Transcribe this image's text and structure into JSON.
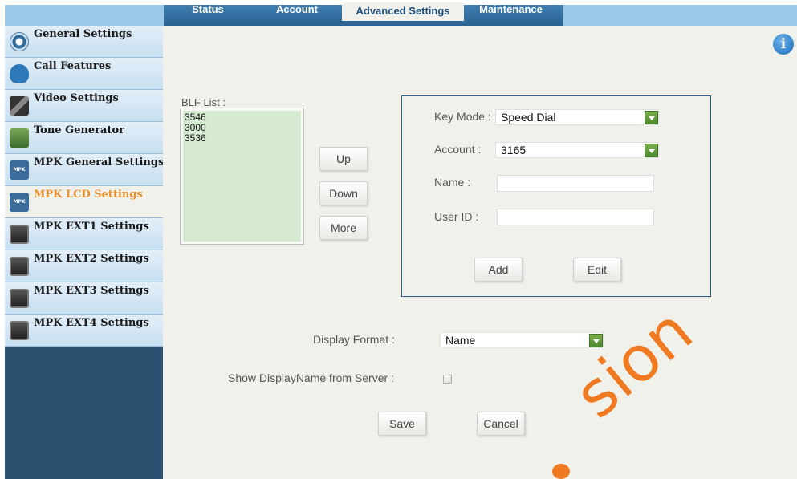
{
  "tabs": [
    {
      "label": "Status"
    },
    {
      "label": "Account"
    },
    {
      "label": "Advanced Settings"
    },
    {
      "label": "Maintenance"
    }
  ],
  "sidebar": {
    "items": [
      {
        "label": "General Settings",
        "icon": "gear-icon"
      },
      {
        "label": "Call Features",
        "icon": "phone-icon"
      },
      {
        "label": "Video Settings",
        "icon": "video-icon"
      },
      {
        "label": "Tone Generator",
        "icon": "music-icon"
      },
      {
        "label": "MPK General Settings",
        "icon": "mpk-icon",
        "icon_text": "MPK"
      },
      {
        "label": "MPK LCD Settings",
        "icon": "mpk-icon",
        "icon_text": "MPK"
      },
      {
        "label": "MPK EXT1 Settings",
        "icon": "extension-module-icon"
      },
      {
        "label": "MPK EXT2 Settings",
        "icon": "extension-module-icon"
      },
      {
        "label": "MPK EXT3 Settings",
        "icon": "extension-module-icon"
      },
      {
        "label": "MPK EXT4 Settings",
        "icon": "extension-module-icon"
      }
    ],
    "active_index": 5
  },
  "info_icon": "i",
  "blf": {
    "title": "BLF List :",
    "entries": [
      "3546",
      "3000",
      "3536"
    ],
    "buttons": {
      "up": "Up",
      "down": "Down",
      "more": "More"
    }
  },
  "panel": {
    "key_mode_label": "Key Mode :",
    "key_mode_value": "Speed Dial",
    "account_label": "Account :",
    "account_value": "3165",
    "name_label": "Name :",
    "name_value": "",
    "userid_label": "User ID :",
    "userid_value": "",
    "add_label": "Add",
    "edit_label": "Edit"
  },
  "display_format": {
    "label": "Display Format :",
    "value": "Name"
  },
  "show_display_name": {
    "label": "Show DisplayName from Server :",
    "checked": false
  },
  "actions": {
    "save": "Save",
    "cancel": "Cancel"
  },
  "watermark": "sion",
  "colors": {
    "tab_bar_dark": "#2a6293",
    "sidebar_bg": "#2b4f6e",
    "active_item_text": "#e8902a",
    "blf_list_bg": "#d6ead2",
    "panel_border": "#2b5e8e",
    "dropdown_arrow": "#5c9a38",
    "watermark": "#f07a22"
  }
}
